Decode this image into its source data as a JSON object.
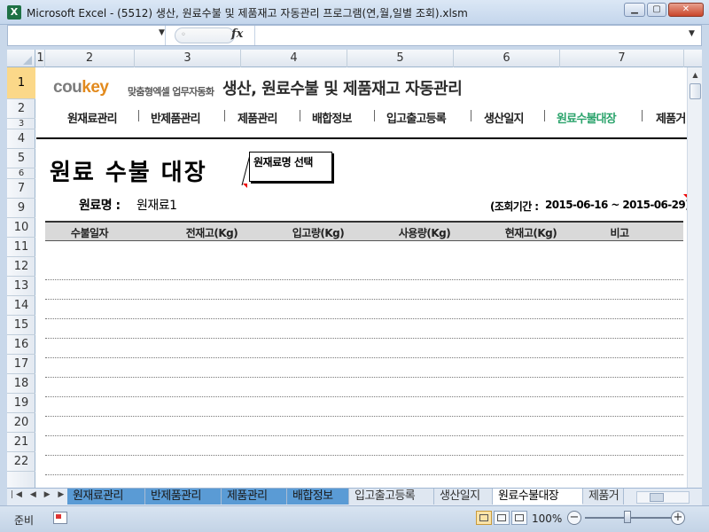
{
  "window": {
    "app_icon": "X",
    "title": "Microsoft Excel - (5512) 생산, 원료수불 및 제품재고 자동관리 프로그램(연,월,일별 조회).xlsm",
    "minimize_icon": "minimize-icon",
    "maximize_icon": "maximize-icon",
    "close_icon": "close-icon"
  },
  "formula_bar": {
    "namebox_value": "",
    "fx_label": "fx",
    "formula_value": ""
  },
  "columns": [
    "1",
    "2",
    "3",
    "4",
    "5",
    "6",
    "7"
  ],
  "rows": [
    "1",
    "2",
    "3",
    "4",
    "5",
    "6",
    "7",
    "9",
    "10",
    "11",
    "12",
    "13",
    "14",
    "15",
    "16",
    "17",
    "18",
    "19",
    "20",
    "21",
    "22"
  ],
  "sheet": {
    "logo": {
      "part1": "cou",
      "part2": "key",
      "tagline": "맞춤형엑셀 업무자동화",
      "color_cou": "#7c7c7c",
      "color_key": "#e28a1d"
    },
    "app_title": "생산, 원료수불 및 제품재고 자동관리",
    "nav": [
      "원재료관리",
      "반제품관리",
      "제품관리",
      "배합정보",
      "입고출고등록",
      "생산일지",
      "원료수불대장",
      "제품거"
    ],
    "nav_active_index": 6,
    "nav_active_color": "#2aa36b",
    "page_heading": "원료 수불 대장",
    "comment_text": "원재료명 선택",
    "material_label": "원료명 :",
    "material_value": "원재료1",
    "period_label": "(조회기간 :",
    "period_value": "2015-06-16 ~ 2015-06-29)",
    "table_headers": [
      "수불일자",
      "전재고(Kg)",
      "입고량(Kg)",
      "사용량(Kg)",
      "현재고(Kg)",
      "비고"
    ],
    "table_rows": [
      [],
      [],
      [],
      [],
      [],
      [],
      [],
      [],
      [],
      [],
      [],
      []
    ]
  },
  "tabs": [
    {
      "label": "원재료관리",
      "style": "colored"
    },
    {
      "label": "반제품관리",
      "style": "colored"
    },
    {
      "label": "제품관리",
      "style": "colored"
    },
    {
      "label": "배합정보",
      "style": "colored"
    },
    {
      "label": "입고출고등록",
      "style": "normal"
    },
    {
      "label": "생산일지",
      "style": "normal"
    },
    {
      "label": "원료수불대장",
      "style": "active"
    },
    {
      "label": "제품거",
      "style": "normal"
    }
  ],
  "status": {
    "ready": "준비",
    "zoom": "100%",
    "zoom_fraction": 0.5
  }
}
